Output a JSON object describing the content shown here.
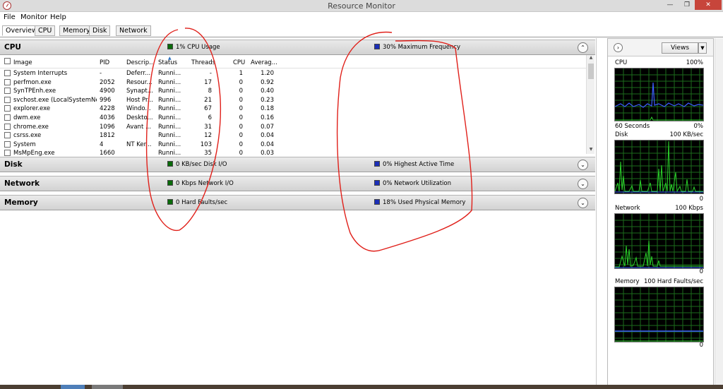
{
  "window": {
    "title": "Resource Monitor",
    "min_label": "—",
    "max_label": "❐",
    "close_label": "✕"
  },
  "menu": [
    "File",
    "Monitor",
    "Help"
  ],
  "tabs": [
    "Overview",
    "CPU",
    "Memory",
    "Disk",
    "Network"
  ],
  "active_tab": "Overview",
  "sections": {
    "cpu": {
      "name": "CPU",
      "metric1": "1% CPU Usage",
      "metric1_color": "#0a6b0a",
      "metric2": "30% Maximum Frequency",
      "metric2_color": "#1c2fb8",
      "toggle": "⌃"
    },
    "disk": {
      "name": "Disk",
      "metric1": "0 KB/sec Disk I/O",
      "metric1_color": "#0a6b0a",
      "metric2": "0% Highest Active Time",
      "metric2_color": "#1c2fb8",
      "toggle": "⌄"
    },
    "network": {
      "name": "Network",
      "metric1": "0 Kbps Network I/O",
      "metric1_color": "#0a6b0a",
      "metric2": "0% Network Utilization",
      "metric2_color": "#1c2fb8",
      "toggle": "⌄"
    },
    "memory": {
      "name": "Memory",
      "metric1": "0 Hard Faults/sec",
      "metric1_color": "#0a6b0a",
      "metric2": "18% Used Physical Memory",
      "metric2_color": "#1c2fb8",
      "toggle": "⌄"
    }
  },
  "cpu_table": {
    "columns": [
      "Image",
      "PID",
      "Descrip...",
      "Status",
      "Threads",
      "CPU",
      "Averag..."
    ],
    "rows": [
      [
        "System Interrupts",
        "-",
        "Deferr...",
        "Runni...",
        "-",
        "1",
        "1.20"
      ],
      [
        "perfmon.exe",
        "2052",
        "Resour...",
        "Runni...",
        "17",
        "0",
        "0.92"
      ],
      [
        "SynTPEnh.exe",
        "4900",
        "Synapt...",
        "Runni...",
        "8",
        "0",
        "0.40"
      ],
      [
        "svchost.exe (LocalSystemNet...",
        "996",
        "Host Pr...",
        "Runni...",
        "21",
        "0",
        "0.23"
      ],
      [
        "explorer.exe",
        "4228",
        "Windo...",
        "Runni...",
        "67",
        "0",
        "0.18"
      ],
      [
        "dwm.exe",
        "4036",
        "Deskto...",
        "Runni...",
        "6",
        "0",
        "0.16"
      ],
      [
        "chrome.exe",
        "1096",
        "Avant ...",
        "Runni...",
        "31",
        "0",
        "0.07"
      ],
      [
        "csrss.exe",
        "1812",
        "",
        "Runni...",
        "12",
        "0",
        "0.04"
      ],
      [
        "System",
        "4",
        "NT Ker...",
        "Runni...",
        "103",
        "0",
        "0.04"
      ],
      [
        "MsMpEng.exe",
        "1660",
        "",
        "Runni...",
        "35",
        "0",
        "0.03"
      ]
    ]
  },
  "right_panel": {
    "views_label": "Views",
    "graphs": [
      {
        "name": "CPU",
        "max": "100%",
        "footer_left": "60 Seconds",
        "footer_right": "0%"
      },
      {
        "name": "Disk",
        "max": "100 KB/sec",
        "footer_left": "",
        "footer_right": "0"
      },
      {
        "name": "Network",
        "max": "100 Kbps",
        "footer_left": "",
        "footer_right": "0"
      },
      {
        "name": "Memory",
        "max": "100 Hard Faults/sec",
        "footer_left": "",
        "footer_right": "0"
      }
    ]
  }
}
